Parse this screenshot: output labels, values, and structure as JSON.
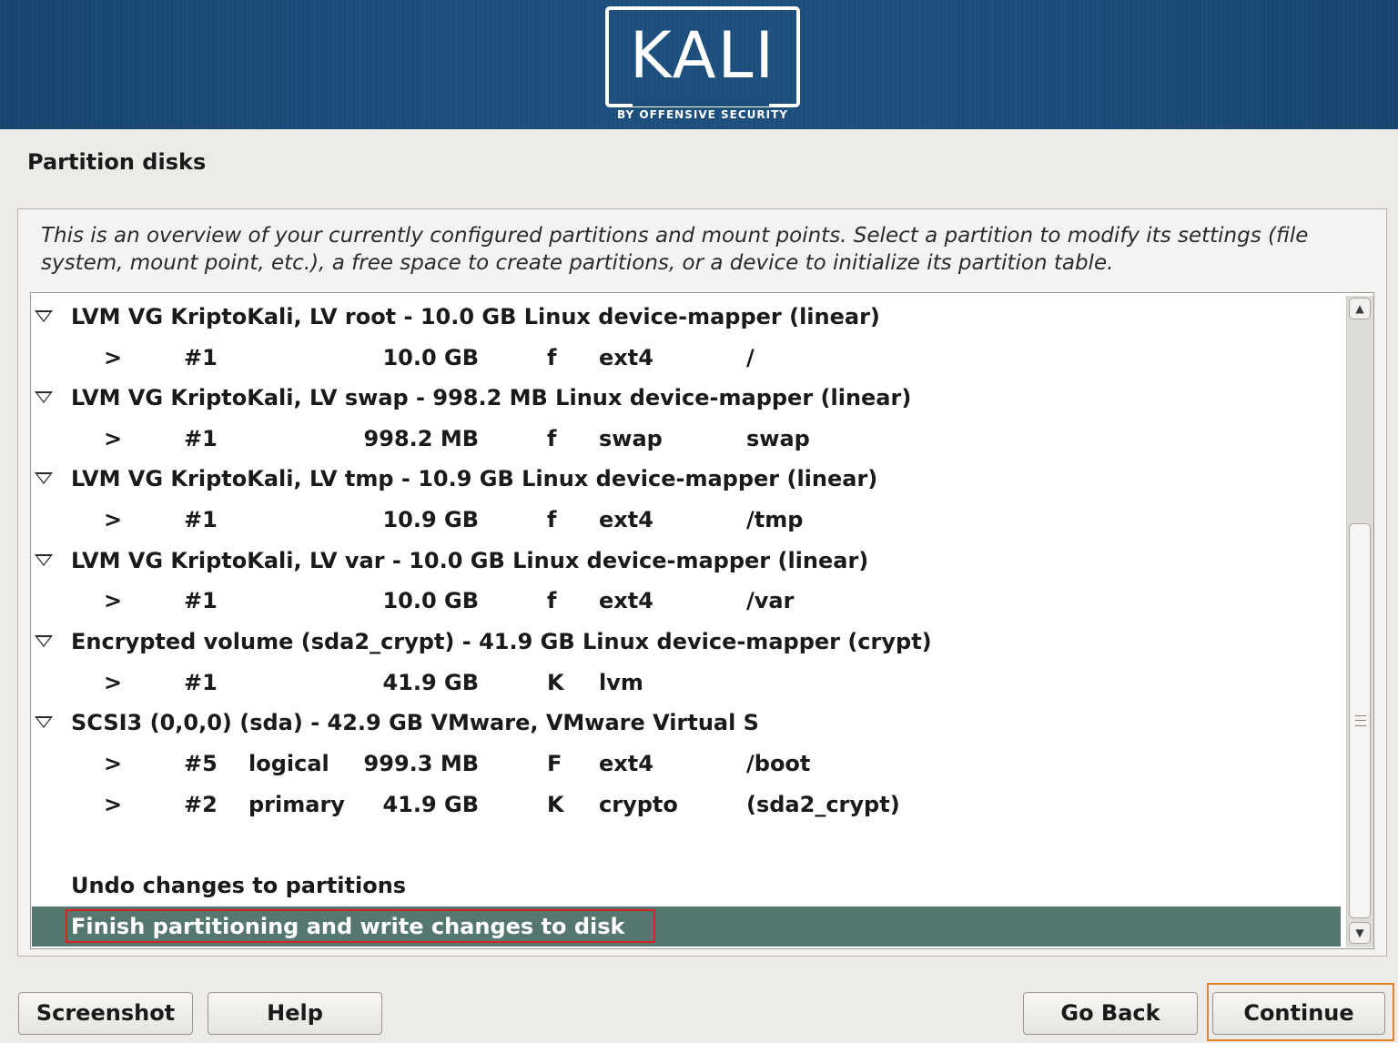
{
  "header": {
    "logo_text": "KALI",
    "logo_subtitle": "BY OFFENSIVE SECURITY"
  },
  "page": {
    "title": "Partition disks",
    "description": "This is an overview of your currently configured partitions and mount points. Select a partition to modify its settings (file system, mount point, etc.), a free space to create partitions, or a device to initialize its partition table."
  },
  "tree": {
    "groups": [
      {
        "label": "LVM VG KriptoKali, LV root - 10.0 GB Linux device-mapper (linear)",
        "partitions": [
          {
            "arrow": ">",
            "number": "#1",
            "type": "",
            "size": "10.0 GB",
            "flag": "f",
            "fs": "ext4",
            "mount": "/"
          }
        ]
      },
      {
        "label": "LVM VG KriptoKali, LV swap - 998.2 MB Linux device-mapper (linear)",
        "partitions": [
          {
            "arrow": ">",
            "number": "#1",
            "type": "",
            "size": "998.2 MB",
            "flag": "f",
            "fs": "swap",
            "mount": "swap"
          }
        ]
      },
      {
        "label": "LVM VG KriptoKali, LV tmp - 10.9 GB Linux device-mapper (linear)",
        "partitions": [
          {
            "arrow": ">",
            "number": "#1",
            "type": "",
            "size": "10.9 GB",
            "flag": "f",
            "fs": "ext4",
            "mount": "/tmp"
          }
        ]
      },
      {
        "label": "LVM VG KriptoKali, LV var - 10.0 GB Linux device-mapper (linear)",
        "partitions": [
          {
            "arrow": ">",
            "number": "#1",
            "type": "",
            "size": "10.0 GB",
            "flag": "f",
            "fs": "ext4",
            "mount": "/var"
          }
        ]
      },
      {
        "label": "Encrypted volume (sda2_crypt) - 41.9 GB Linux device-mapper (crypt)",
        "partitions": [
          {
            "arrow": ">",
            "number": "#1",
            "type": "",
            "size": "41.9 GB",
            "flag": "K",
            "fs": "lvm",
            "mount": ""
          }
        ]
      },
      {
        "label": "SCSI3 (0,0,0) (sda) - 42.9 GB VMware, VMware Virtual S",
        "partitions": [
          {
            "arrow": ">",
            "number": "#5",
            "type": "logical",
            "size": "999.3 MB",
            "flag": "F",
            "fs": "ext4",
            "mount": "/boot"
          },
          {
            "arrow": ">",
            "number": "#2",
            "type": "primary",
            "size": "41.9 GB",
            "flag": "K",
            "fs": "crypto",
            "mount": "(sda2_crypt)"
          }
        ]
      }
    ],
    "actions": {
      "undo": "Undo changes to partitions",
      "finish": "Finish partitioning and write changes to disk"
    }
  },
  "buttons": {
    "screenshot": "Screenshot",
    "help": "Help",
    "go_back": "Go Back",
    "continue": "Continue"
  },
  "colors": {
    "banner": "#1d4f7e",
    "selected_row": "#55776f",
    "highlight_box": "#d92222",
    "focus_ring": "#e67e22"
  }
}
